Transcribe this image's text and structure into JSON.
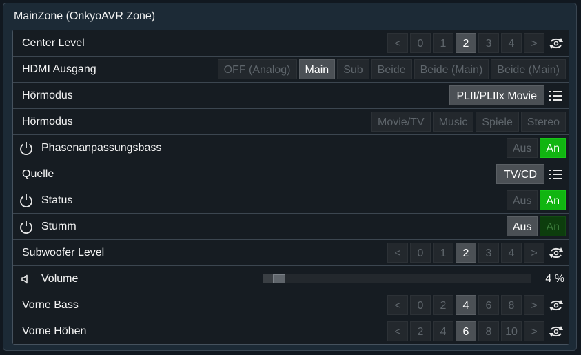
{
  "panel": {
    "title": "MainZone (OnkyoAVR Zone)"
  },
  "rows": [
    {
      "label": "Center Level",
      "prev": "<",
      "next": ">",
      "values": [
        "0",
        "1",
        "2",
        "3",
        "4"
      ],
      "selected": "2"
    },
    {
      "label": "HDMI Ausgang",
      "options": [
        "OFF (Analog)",
        "Main",
        "Sub",
        "Beide",
        "Beide (Main)",
        "Beide (Main)"
      ],
      "selected": "Main"
    },
    {
      "label": "Hörmodus",
      "value": "PLII/PLIIx Movie"
    },
    {
      "label": "Hörmodus",
      "options": [
        "Movie/TV",
        "Music",
        "Spiele",
        "Stereo"
      ]
    },
    {
      "label": "Phasenanpassungsbass",
      "off": "Aus",
      "on": "An",
      "state": "on"
    },
    {
      "label": "Quelle",
      "value": "TV/CD"
    },
    {
      "label": "Status",
      "off": "Aus",
      "on": "An",
      "state": "on"
    },
    {
      "label": "Stumm",
      "off": "Aus",
      "on": "An",
      "state": "off"
    },
    {
      "label": "Subwoofer Level",
      "prev": "<",
      "next": ">",
      "values": [
        "0",
        "1",
        "2",
        "3",
        "4"
      ],
      "selected": "2"
    },
    {
      "label": "Volume",
      "value_text": "4 %",
      "level_percent": 4
    },
    {
      "label": "Vorne Bass",
      "prev": "<",
      "next": ">",
      "values": [
        "0",
        "2",
        "4",
        "6",
        "8"
      ],
      "selected": "4"
    },
    {
      "label": "Vorne Höhen",
      "prev": "<",
      "next": ">",
      "values": [
        "2",
        "4",
        "6",
        "8",
        "10"
      ],
      "selected": "6"
    }
  ],
  "icons": {
    "power": "power-icon",
    "list": "list-icon",
    "refresh": "refresh-icon",
    "speaker": "speaker-icon"
  },
  "colors": {
    "accent_on": "#11b511",
    "selected_bg": "#4b5055",
    "panel_bg": "#1c2a36",
    "row_bg": "#161c22"
  }
}
